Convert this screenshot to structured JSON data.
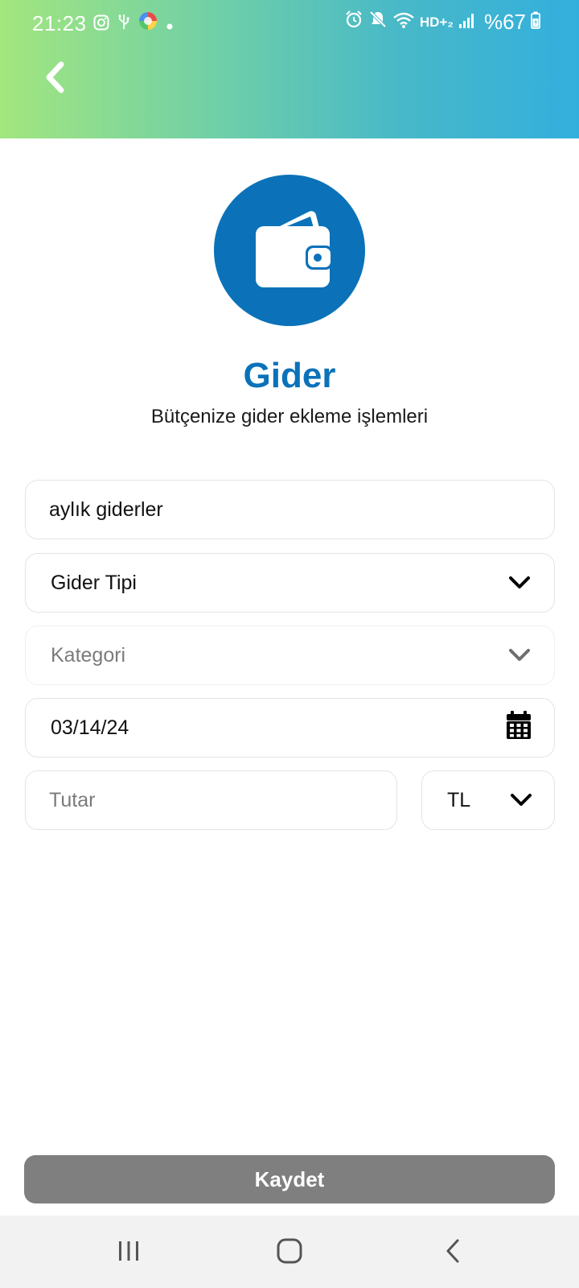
{
  "status_bar": {
    "time": "21:23",
    "battery": "%67",
    "network": "HD+₂",
    "icons_left": [
      "instagram-icon",
      "usb-icon",
      "colorful-app-icon",
      "dot-icon"
    ],
    "icons_right": [
      "alarm-icon",
      "mute-icon",
      "wifi-icon",
      "signal-icon",
      "battery-icon"
    ]
  },
  "header": {
    "back_icon": "chevron-left-icon",
    "colors": {
      "gradient_start": "#a3e67e",
      "gradient_end": "#33afde"
    }
  },
  "hero": {
    "icon": "wallet-icon",
    "title": "Gider",
    "subtitle": "Bütçenize gider ekleme işlemleri",
    "accent_color": "#0b72b9"
  },
  "form": {
    "name": {
      "value": "aylık giderler"
    },
    "expense_type": {
      "value": "Gider Tipi"
    },
    "category": {
      "placeholder": "Kategori"
    },
    "date": {
      "value": "03/14/24"
    },
    "amount": {
      "placeholder": "Tutar"
    },
    "currency": {
      "value": "TL"
    }
  },
  "actions": {
    "save_label": "Kaydet",
    "save_color": "#7f7f7f"
  },
  "nav_bar": {
    "items": [
      "recents-icon",
      "home-icon",
      "back-icon"
    ]
  }
}
